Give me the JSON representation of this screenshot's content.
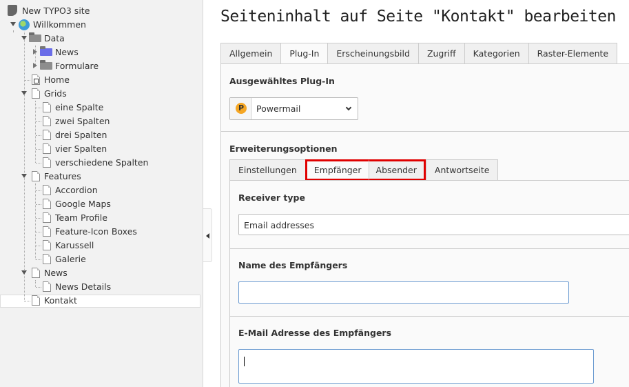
{
  "tree": {
    "root": "New TYPO3 site",
    "items": [
      "Willkommen",
      "Data",
      "News",
      "Formulare",
      "Home",
      "Grids",
      "eine Spalte",
      "zwei Spalten",
      "drei Spalten",
      "vier Spalten",
      "verschiedene Spalten",
      "Features",
      "Accordion",
      "Google Maps",
      "Team Profile",
      "Feature-Icon Boxes",
      "Karussell",
      "Galerie",
      "News",
      "News Details",
      "Kontakt"
    ]
  },
  "page_title": "Seiteninhalt auf Seite \"Kontakt\" bearbeiten",
  "tabs_top": [
    "Allgemein",
    "Plug-In",
    "Erscheinungsbild",
    "Zugriff",
    "Kategorien",
    "Raster-Elemente"
  ],
  "plugin": {
    "section_title": "Ausgewähltes Plug-In",
    "selected": "Powermail"
  },
  "extension": {
    "section_title": "Erweiterungsoptionen",
    "tabs": [
      "Einstellungen",
      "Empfänger",
      "Absender",
      "Antwortseite"
    ]
  },
  "fields": {
    "receiver_type_label": "Receiver type",
    "receiver_type_value": "Email addresses",
    "receiver_name_label": "Name des Empfängers",
    "receiver_email_label": "E-Mail Adresse des Empfängers"
  },
  "colors": {
    "highlight": "#e00000",
    "focus_border": "#6b9bd1"
  }
}
